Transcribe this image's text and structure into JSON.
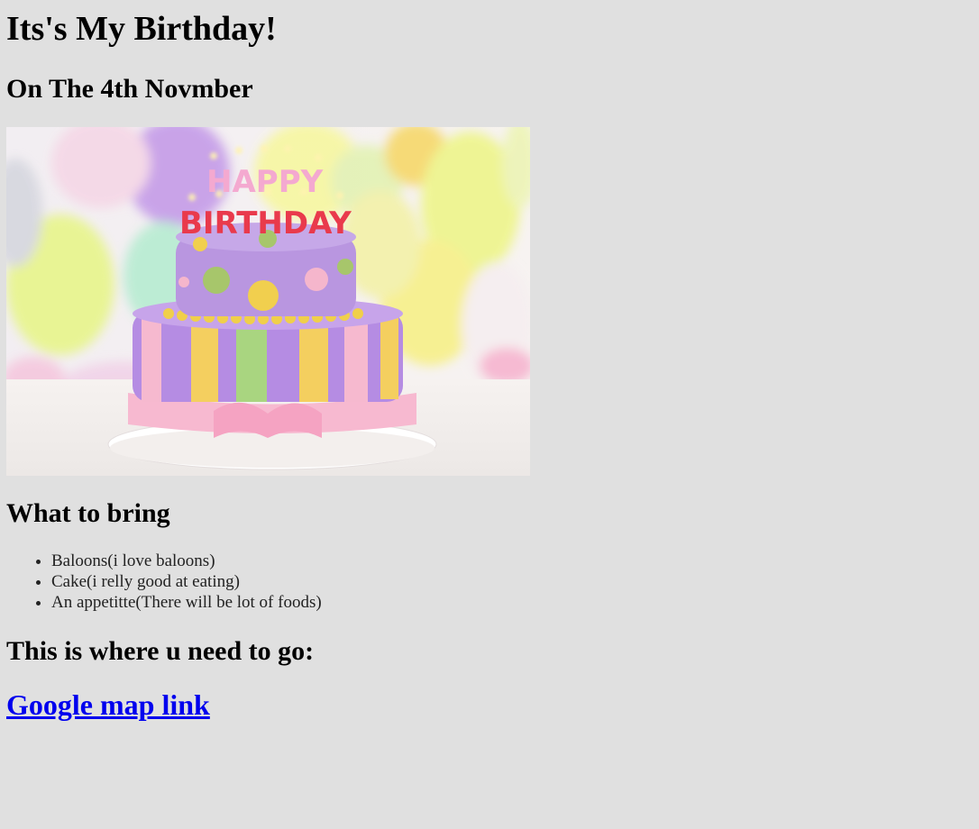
{
  "header": {
    "title": "Its's My Birthday!",
    "date_line": "On The 4th Novmber"
  },
  "photo": {
    "topper_top": "HAPPY",
    "topper_bottom": "BIRTHDAY"
  },
  "bring": {
    "heading": "What to bring",
    "items": [
      "Baloons(i love baloons)",
      "Cake(i relly good at eating)",
      "An appetitte(There will be lot of foods)"
    ]
  },
  "location": {
    "heading": "This is where u need to go:",
    "link_label": "Google map link"
  },
  "colors": {
    "background": "#e0e0e0",
    "link": "#0000ee"
  }
}
